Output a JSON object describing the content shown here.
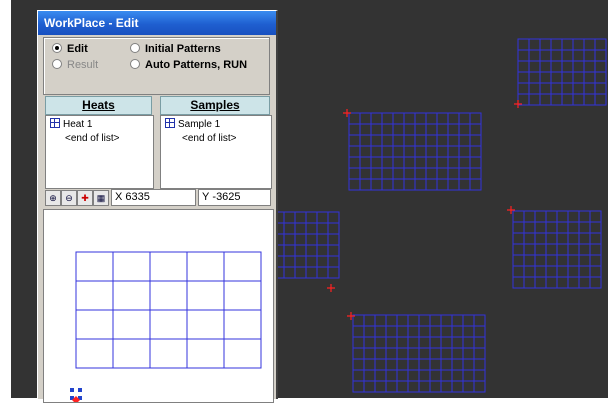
{
  "window": {
    "title": "WorkPlace - Edit"
  },
  "modes": {
    "edit": "Edit",
    "initial": "Initial Patterns",
    "result": "Result",
    "auto": "Auto Patterns, RUN",
    "selected": "Edit"
  },
  "heats": {
    "header": "Heats",
    "items": [
      "Heat 1"
    ],
    "end": "<end of list>"
  },
  "samples": {
    "header": "Samples",
    "items": [
      "Sample 1"
    ],
    "end": "<end of list>"
  },
  "toolbar": {
    "x_label": "X",
    "x_value": "6335",
    "y_label": "Y",
    "y_value": "-3625"
  },
  "colors": {
    "grid": "#3333dd",
    "marker": "#ff2222",
    "background": "#333333",
    "panel": "#d4d0c8"
  },
  "icons": [
    "zoom-in-icon",
    "zoom-out-icon",
    "fit-icon",
    "grid-icon"
  ]
}
